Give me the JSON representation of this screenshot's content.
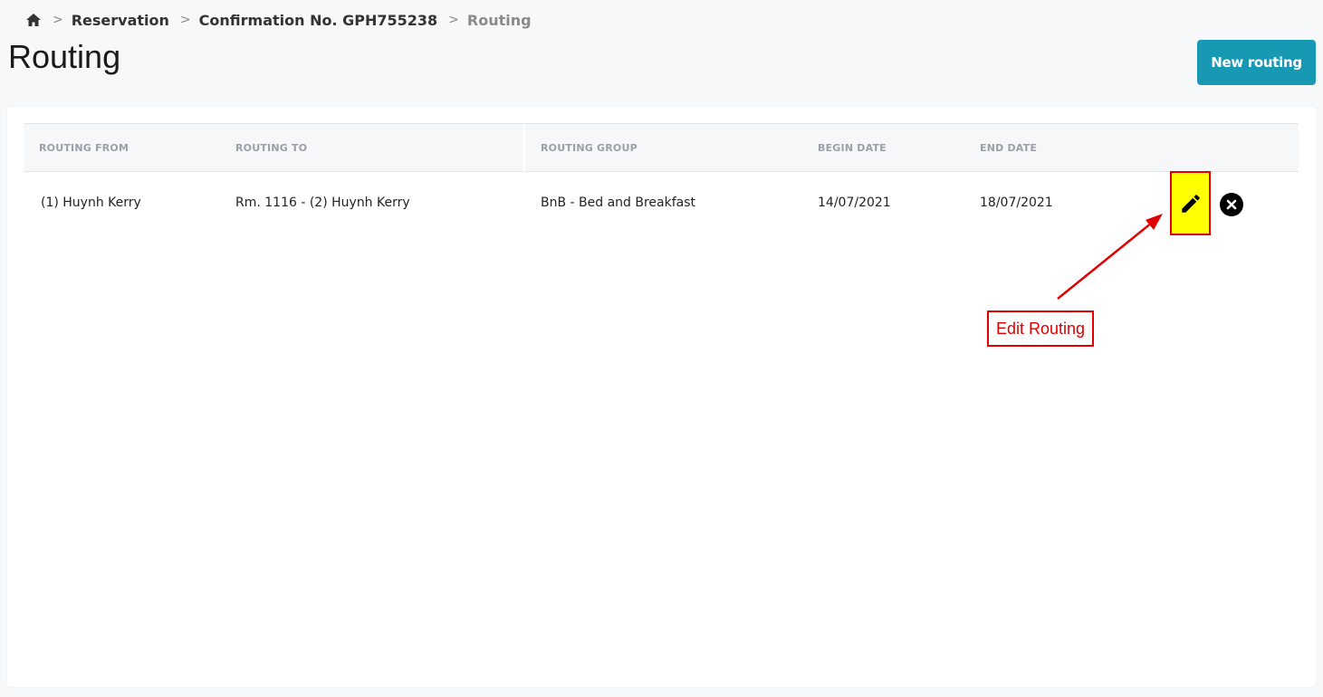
{
  "breadcrumb": {
    "items": [
      "Reservation",
      "Confirmation No. GPH755238"
    ],
    "current": "Routing"
  },
  "page": {
    "title": "Routing",
    "new_button": "New routing"
  },
  "table": {
    "headers": [
      "ROUTING FROM",
      "ROUTING TO",
      "ROUTING GROUP",
      "BEGIN DATE",
      "END DATE"
    ],
    "rows": [
      {
        "from": "(1) Huynh Kerry",
        "to": "Rm. 1116 - (2) Huynh Kerry",
        "group": "BnB - Bed and Breakfast",
        "begin": "14/07/2021",
        "end": "18/07/2021"
      }
    ]
  },
  "annotation": {
    "label": "Edit Routing",
    "color": "#e00000",
    "highlight": "#ffff00"
  },
  "colors": {
    "accent": "#1899b3"
  }
}
